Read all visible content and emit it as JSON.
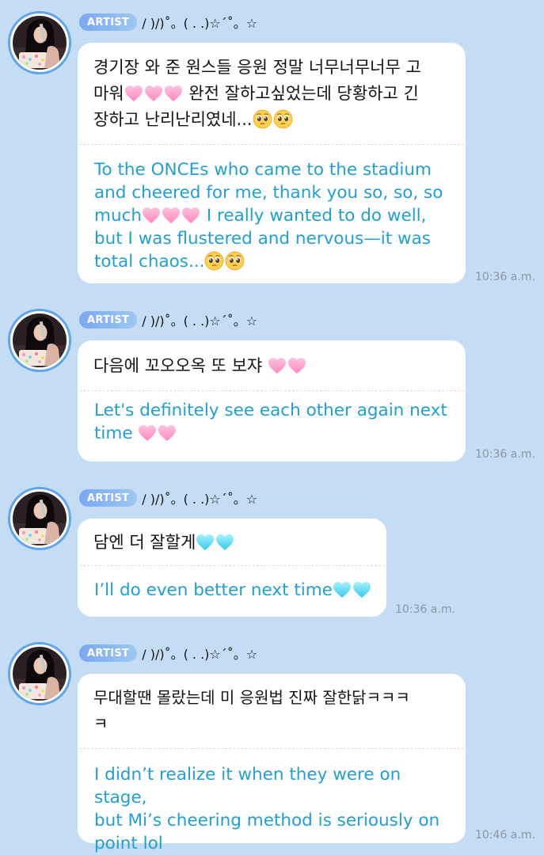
{
  "messages": [
    {
      "badge": "ARTIST",
      "nickname": "/ )/)˚。( . .)☆´˚。☆",
      "ko_lines": [
        "경기장 와 준 원스들 응원 정말 너무너무너무 고",
        "마워",
        " 완전 잘하고싶었는데 당황하고 긴",
        "장하고 난리난리였네..."
      ],
      "en_lines": [
        "To the ONCEs who came to the stadium",
        "and cheered for me, thank you so, so, so",
        "much",
        " I really wanted to do well,",
        "but I was flustered and nervous—it was",
        "total chaos..."
      ],
      "time": "10:36 a.m."
    },
    {
      "badge": "ARTIST",
      "nickname": "/ )/)˚。( . .)☆´˚。☆",
      "ko_text": "다음에 꼬오오옥 또 보쟈 ",
      "en_lines": [
        "Let's definitely see each other again next",
        "time "
      ],
      "time": "10:36 a.m."
    },
    {
      "badge": "ARTIST",
      "nickname": "/ )/)˚。( . .)☆´˚。☆",
      "ko_text": "담엔 더 잘할게",
      "en_text": "I’ll do even better next time",
      "time": "10:36 a.m."
    },
    {
      "badge": "ARTIST",
      "nickname": "/ )/)˚。( . .)☆´˚。☆",
      "ko_lines": [
        "무대할땐 몰랐는데 미 응원법 진짜 잘한닭ㅋㅋㅋ",
        "ㅋ"
      ],
      "en_lines": [
        "I didn’t realize it when they were on stage,",
        "but Mi’s cheering method is seriously on",
        "point lol"
      ],
      "time": "10:46 a.m."
    }
  ],
  "icons": {
    "pink_heart": "pink-heart-icon",
    "blue_heart": "light-blue-heart-icon",
    "pleading": "pleading-face-icon"
  },
  "colors": {
    "background": "#c5ddf4",
    "badge": "#79a7f2",
    "translation_text": "#1f9fd3",
    "pink_heart": "#ff9dcb",
    "blue_heart": "#55d8f1",
    "avatar_ring": "#5fa5ee"
  }
}
